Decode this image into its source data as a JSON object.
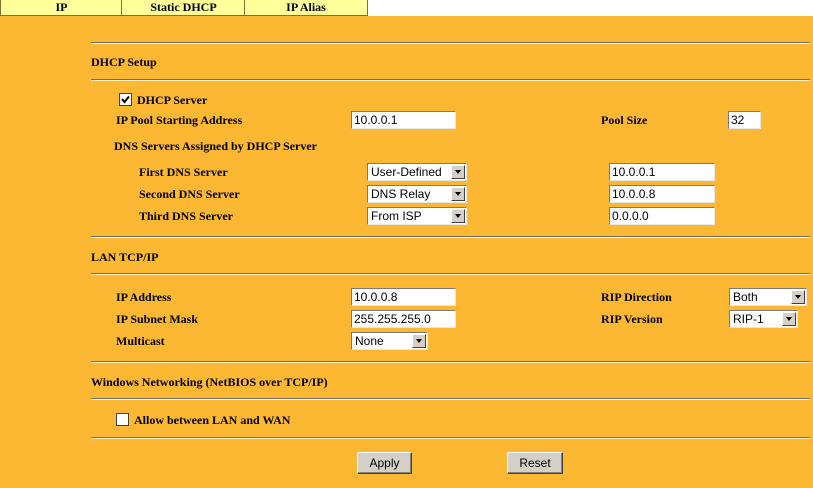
{
  "tabs": [
    {
      "label": "IP"
    },
    {
      "label": "Static DHCP"
    },
    {
      "label": "IP Alias"
    }
  ],
  "dhcp": {
    "section_title": "DHCP Setup",
    "server_label": "DHCP Server",
    "server_enabled": true,
    "pool_start_label": "IP Pool Starting Address",
    "pool_start_value": "10.0.0.1",
    "pool_size_label": "Pool Size",
    "pool_size_value": "32",
    "dns_header": "DNS Servers Assigned by DHCP Server",
    "dns": [
      {
        "label": "First DNS Server",
        "mode": "User-Defined",
        "ip": "10.0.0.1"
      },
      {
        "label": "Second DNS Server",
        "mode": "DNS Relay",
        "ip": "10.0.0.8"
      },
      {
        "label": "Third DNS Server",
        "mode": "From ISP",
        "ip": "0.0.0.0"
      }
    ]
  },
  "lan": {
    "section_title": "LAN TCP/IP",
    "ip_label": "IP Address",
    "ip_value": "10.0.0.8",
    "mask_label": "IP Subnet Mask",
    "mask_value": "255.255.255.0",
    "multicast_label": "Multicast",
    "multicast_value": "None",
    "rip_direction_label": "RIP Direction",
    "rip_direction_value": "Both",
    "rip_version_label": "RIP Version",
    "rip_version_value": "RIP-1"
  },
  "netbios": {
    "section_title": "Windows Networking (NetBIOS over TCP/IP)",
    "allow_label": "Allow between LAN and WAN",
    "allow_enabled": false
  },
  "buttons": {
    "apply": "Apply",
    "reset": "Reset"
  },
  "colors": {
    "panel_bg": "#FCB833",
    "tab_bg": "#FEFE9A"
  }
}
